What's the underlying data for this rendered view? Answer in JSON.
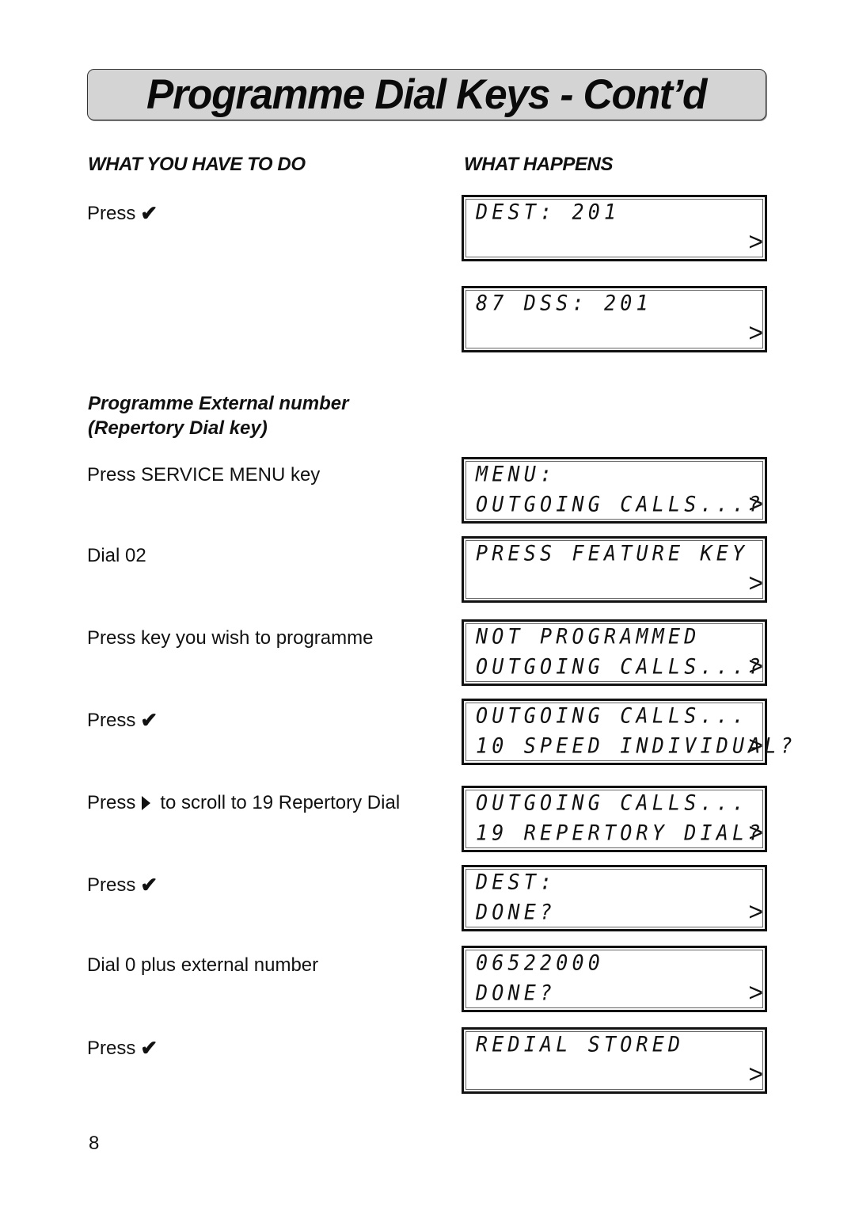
{
  "page": {
    "title": "Programme Dial Keys - Cont’d",
    "column_left_heading": "WHAT YOU HAVE TO DO",
    "column_right_heading": "WHAT HAPPENS",
    "section_heading_line1": "Programme External number",
    "section_heading_line2": "(Repertory Dial key)",
    "page_number": "8"
  },
  "icons": {
    "check": "✔",
    "right_triangle": "right-triangle-icon",
    "lcd_arrow": ">"
  },
  "steps": [
    {
      "text": "Press",
      "icon": "check"
    },
    {
      "text": "Press SERVICE MENU key"
    },
    {
      "text": "Dial 02"
    },
    {
      "text": "Press key you wish to programme"
    },
    {
      "text": "Press",
      "icon": "check"
    },
    {
      "text_before": "Press",
      "text_after": "to scroll to 19 Repertory Dial",
      "icon": "right_triangle"
    },
    {
      "text": "Press",
      "icon": "check"
    },
    {
      "text": "Dial 0 plus external number"
    },
    {
      "text": "Press",
      "icon": "check"
    }
  ],
  "displays": [
    {
      "line1": "DEST: 201",
      "line2": ""
    },
    {
      "line1": "87 DSS: 201",
      "line2": ""
    },
    {
      "line1": "MENU:",
      "line2": "OUTGOING CALLS...?"
    },
    {
      "line1": "PRESS FEATURE KEY",
      "line2": ""
    },
    {
      "line1": "NOT PROGRAMMED",
      "line2": "OUTGOING CALLS...?"
    },
    {
      "line1": "OUTGOING CALLS...",
      "line2": "10 SPEED INDIVIDUAL?"
    },
    {
      "line1": "OUTGOING CALLS...",
      "line2": "19 REPERTORY DIAL?"
    },
    {
      "line1": "DEST:",
      "line2": "DONE?"
    },
    {
      "line1": "06522000",
      "line2": "DONE?"
    },
    {
      "line1": "REDIAL STORED",
      "line2": ""
    }
  ]
}
